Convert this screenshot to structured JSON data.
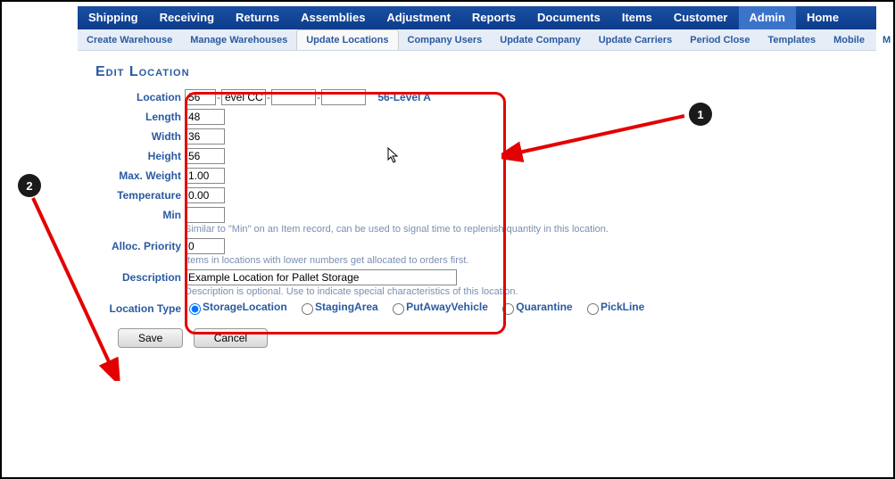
{
  "nav": {
    "items": [
      "Shipping",
      "Receiving",
      "Returns",
      "Assemblies",
      "Adjustment",
      "Reports",
      "Documents",
      "Items",
      "Customer",
      "Admin",
      "Home"
    ],
    "active": "Admin"
  },
  "subnav": {
    "items": [
      "Create Warehouse",
      "Manage Warehouses",
      "Update Locations",
      "Company Users",
      "Update Company",
      "Update Carriers",
      "Period Close",
      "Templates",
      "Mobile",
      "M"
    ],
    "active": "Update Locations"
  },
  "page": {
    "title": "Edit Location"
  },
  "labels": {
    "location": "Location",
    "length": "Length",
    "width": "Width",
    "height": "Height",
    "max_weight": "Max. Weight",
    "temperature": "Temperature",
    "min": "Min",
    "alloc_priority": "Alloc. Priority",
    "description": "Description",
    "location_type": "Location Type"
  },
  "values": {
    "loc1": "56",
    "loc2": "evel CC",
    "loc3": "",
    "loc4": "",
    "loc_display": "56-Level A",
    "length": "48",
    "width": "36",
    "height": "56",
    "max_weight": "1.00",
    "temperature": "0.00",
    "min": "",
    "alloc_priority": "0",
    "description": "Example Location for Pallet Storage"
  },
  "hints": {
    "min": "Similar to \"Min\" on an Item record, can be used to signal time to replenish quantity in this location.",
    "alloc": "Items in locations with lower numbers get allocated to orders first.",
    "desc": "Description is optional. Use to indicate special characteristics of this location."
  },
  "location_type": {
    "options": [
      "StorageLocation",
      "StagingArea",
      "PutAwayVehicle",
      "Quarantine",
      "PickLine"
    ],
    "selected": "StorageLocation"
  },
  "buttons": {
    "save": "Save",
    "cancel": "Cancel"
  },
  "annotations": {
    "one": "1",
    "two": "2"
  }
}
